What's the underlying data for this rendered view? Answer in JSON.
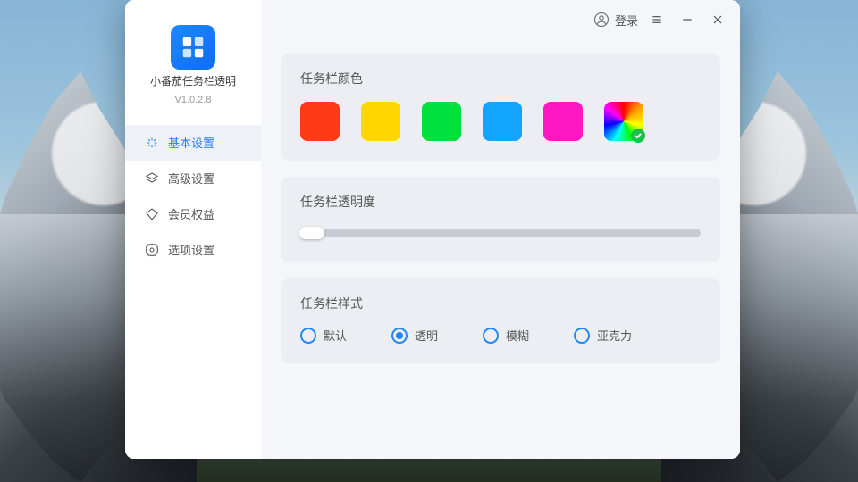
{
  "app": {
    "name": "小番茄任务栏透明",
    "version": "V1.0.2.8"
  },
  "titlebar": {
    "login_label": "登录"
  },
  "sidebar": {
    "items": [
      {
        "label": "基本设置",
        "active": true
      },
      {
        "label": "高级设置",
        "active": false
      },
      {
        "label": "会员权益",
        "active": false
      },
      {
        "label": "选项设置",
        "active": false
      }
    ]
  },
  "panels": {
    "color": {
      "title": "任务栏颜色",
      "swatches": [
        {
          "color": "#ff3a19",
          "selected": false,
          "name": "red"
        },
        {
          "color": "#ffd600",
          "selected": false,
          "name": "yellow"
        },
        {
          "color": "#00e03c",
          "selected": false,
          "name": "green"
        },
        {
          "color": "#13a4ff",
          "selected": false,
          "name": "blue"
        },
        {
          "color": "#ff17c2",
          "selected": false,
          "name": "magenta"
        },
        {
          "color": "rainbow",
          "selected": true,
          "name": "custom"
        }
      ]
    },
    "opacity": {
      "title": "任务栏透明度",
      "value": 3,
      "min": 0,
      "max": 100
    },
    "style": {
      "title": "任务栏样式",
      "options": [
        {
          "label": "默认",
          "value": "default",
          "selected": false
        },
        {
          "label": "透明",
          "value": "transparent",
          "selected": true
        },
        {
          "label": "模糊",
          "value": "blur",
          "selected": false
        },
        {
          "label": "亚克力",
          "value": "acrylic",
          "selected": false
        }
      ]
    }
  }
}
